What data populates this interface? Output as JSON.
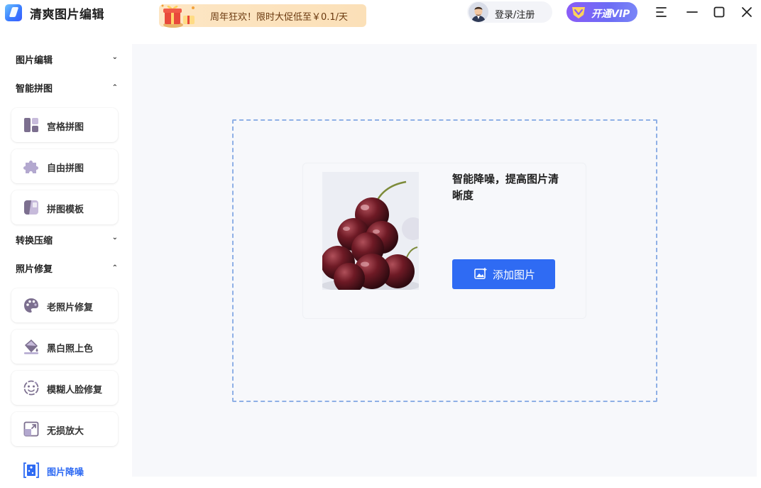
{
  "app": {
    "title": "清爽图片编辑"
  },
  "promo": {
    "text": "周年狂欢！限时大促低至￥0.1/天"
  },
  "account": {
    "login_label": "登录/注册"
  },
  "vip": {
    "label": "开通VIP"
  },
  "colors": {
    "accent": "#2f6bf3",
    "vip_start": "#8a5cf7",
    "vip_end": "#7a86f7",
    "dropzone_border": "#8fb0e6"
  },
  "sidebar": {
    "groups": [
      {
        "label": "图片编辑",
        "expanded": false
      },
      {
        "label": "智能拼图",
        "expanded": true
      },
      {
        "label": "转换压缩",
        "expanded": false
      },
      {
        "label": "照片修复",
        "expanded": true
      }
    ],
    "collage_tools": [
      {
        "label": "宫格拼图",
        "icon": "grid-collage-icon"
      },
      {
        "label": "自由拼图",
        "icon": "puzzle-piece-icon"
      },
      {
        "label": "拼图模板",
        "icon": "template-icon"
      }
    ],
    "repair_tools": [
      {
        "label": "老照片修复",
        "icon": "palette-icon"
      },
      {
        "label": "黑白照上色",
        "icon": "paint-bucket-icon"
      },
      {
        "label": "模糊人脸修复",
        "icon": "face-icon"
      },
      {
        "label": "无损放大",
        "icon": "enlarge-icon"
      },
      {
        "label": "图片降噪",
        "icon": "denoise-icon",
        "active": true
      }
    ]
  },
  "main": {
    "card_title": "智能降噪，提高图片清晰度",
    "add_button_label": "添加图片",
    "sample_image": "cherries"
  }
}
